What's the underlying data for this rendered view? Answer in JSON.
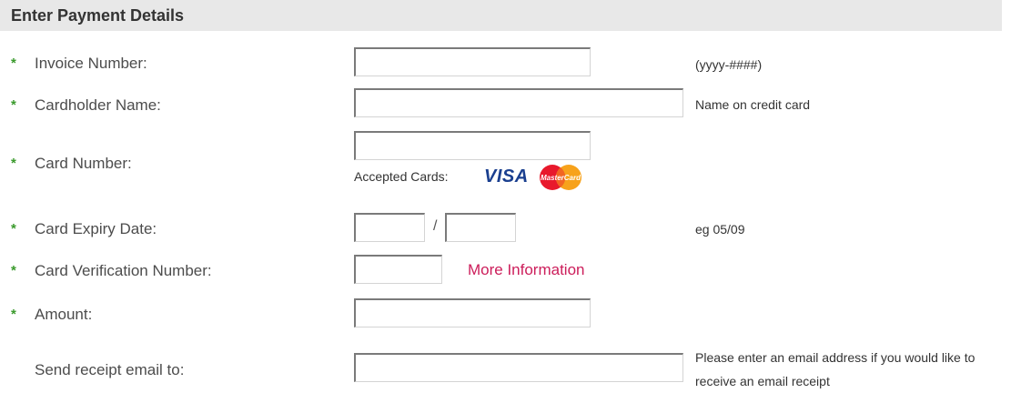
{
  "header": {
    "title": "Enter Payment Details"
  },
  "required_marker": "*",
  "fields": {
    "invoice": {
      "label": "Invoice Number:",
      "value": "",
      "hint": "(yyyy-####)"
    },
    "cardholder": {
      "label": "Cardholder Name:",
      "value": "",
      "hint": "Name on credit card"
    },
    "card_number": {
      "label": "Card Number:",
      "value": "",
      "accepted_label": "Accepted Cards:",
      "cards": [
        "visa-logo",
        "mastercard-logo"
      ],
      "visa_text": "VISA",
      "mastercard_text": "MasterCard"
    },
    "expiry": {
      "label": "Card Expiry Date:",
      "month": "",
      "year": "",
      "separator": "/",
      "hint": "eg 05/09"
    },
    "cvn": {
      "label": "Card Verification Number:",
      "value": "",
      "link": "More Information"
    },
    "amount": {
      "label": "Amount:",
      "value": ""
    },
    "email": {
      "label": "Send receipt email to:",
      "value": "",
      "hint": "Please enter an email address if you would like to receive an email receipt"
    }
  },
  "colors": {
    "header_bg": "#e8e8e8",
    "required_star": "#3a9a2c",
    "link": "#cc1d5a",
    "label": "#4c4c4c"
  }
}
